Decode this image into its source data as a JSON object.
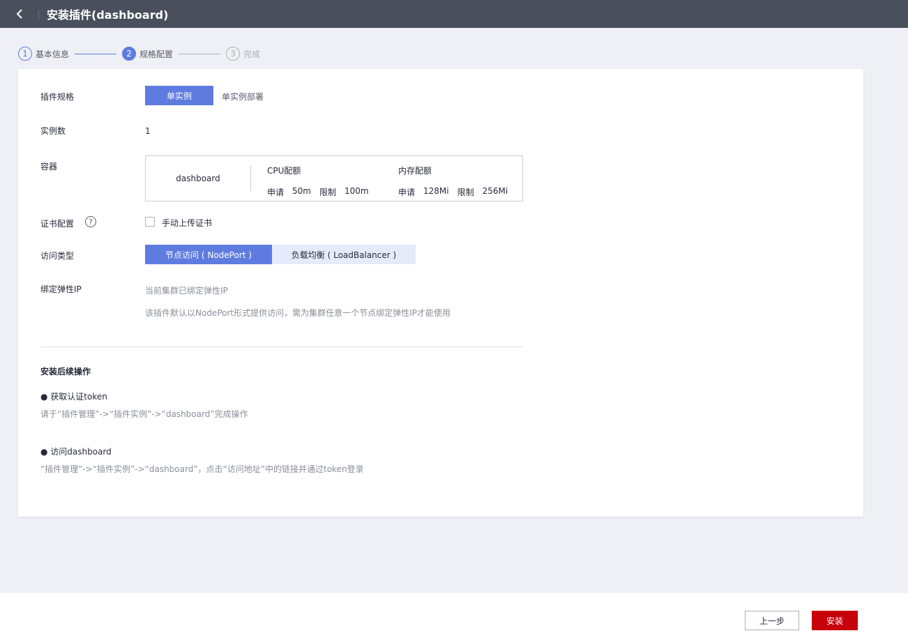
{
  "header": {
    "title": "安装插件(dashboard)"
  },
  "steps": [
    {
      "num": "1",
      "label": "基本信息"
    },
    {
      "num": "2",
      "label": "规格配置"
    },
    {
      "num": "3",
      "label": "完成"
    }
  ],
  "form": {
    "spec": {
      "label": "插件规格",
      "option": "单实例",
      "desc": "单实例部署"
    },
    "instances": {
      "label": "实例数",
      "value": "1"
    },
    "container": {
      "label": "容器",
      "name": "dashboard",
      "cpu": {
        "title": "CPU配额",
        "request_label": "申请",
        "request_value": "50m",
        "limit_label": "限制",
        "limit_value": "100m"
      },
      "memory": {
        "title": "内存配额",
        "request_label": "申请",
        "request_value": "128Mi",
        "limit_label": "限制",
        "limit_value": "256Mi"
      }
    },
    "cert": {
      "label": "证书配置",
      "help": "?",
      "checkbox_label": "手动上传证书",
      "checked": false
    },
    "access": {
      "label": "访问类型",
      "options": [
        "节点访问 ( NodePort )",
        "负载均衡 ( LoadBalancer )"
      ],
      "selected": "节点访问 ( NodePort )"
    },
    "eip": {
      "label": "绑定弹性IP",
      "status": "当前集群已绑定弹性IP",
      "note": "该插件默认以NodePort形式提供访问，需为集群任意一个节点绑定弹性IP才能使用"
    }
  },
  "post": {
    "title": "安装后续操作",
    "items": [
      {
        "title": "● 获取认证token",
        "desc": "请于“插件管理”->“插件实例”->“dashboard”完成操作"
      },
      {
        "title": "● 访问dashboard",
        "desc": "“插件管理”->“插件实例”->“dashboard”，点击“访问地址”中的链接并通过token登录"
      }
    ]
  },
  "footer": {
    "prev_label": "上一步",
    "install_label": "安装"
  },
  "colors": {
    "header_bg": "#4a4f5c",
    "primary": "#5e7ce0",
    "danger": "#c7000b",
    "page_bg": "#eff0f5"
  }
}
